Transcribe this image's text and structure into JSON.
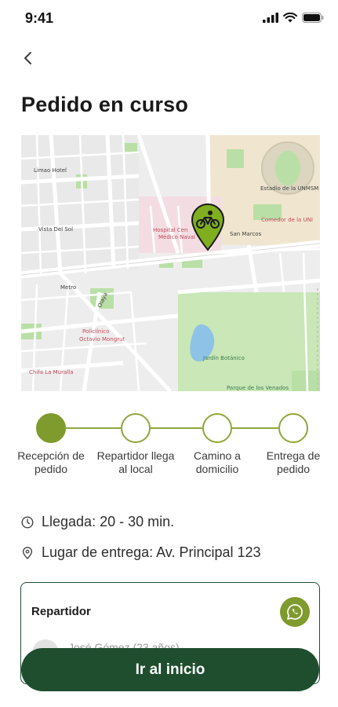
{
  "status_bar": {
    "time": "9:41"
  },
  "header": {
    "title": "Pedido en curso"
  },
  "map": {
    "labels": {
      "limao_hotel": "Limao Hotel",
      "estadio": "Estadio de la UNMSM",
      "vista_del_sol": "Vista Del Sol",
      "hospital": "Hospital Cen",
      "medico_naval": "Médico Naval",
      "san_marcos": "San Marcos",
      "comedor": "Comedor de la UNI",
      "metro": "Metro",
      "olaya": "Olaya",
      "policlinico": "Policlínico",
      "octavio": "Octavio Mongrut",
      "jardin": "Jardín Botánico",
      "chifa": "Chifa La Muralla",
      "parque": "Parque de los Venados"
    },
    "pin_icon": "bicycle-icon",
    "colors": {
      "pin": "#7fae1f",
      "park": "#b9dfa6",
      "water": "#8ec2e6"
    }
  },
  "progress": {
    "steps": [
      {
        "label": "Recepción de pedido",
        "active": true
      },
      {
        "label": "Repartidor llega al local",
        "active": false
      },
      {
        "label": "Camino a domicilio",
        "active": false
      },
      {
        "label": "Entrega de pedido",
        "active": false
      }
    ],
    "accent": "#7f9a2d"
  },
  "arrival": {
    "icon": "clock-icon",
    "text": "Llegada: 20 - 30 min."
  },
  "delivery": {
    "icon": "location-pin-icon",
    "text": "Lugar de entrega: Av. Principal 123"
  },
  "driver": {
    "title": "Repartidor",
    "name": "José Gómez (23 años)",
    "contact_icon": "whatsapp-icon"
  },
  "cta": {
    "label": "Ir al inicio",
    "color": "#1f4e2f"
  }
}
